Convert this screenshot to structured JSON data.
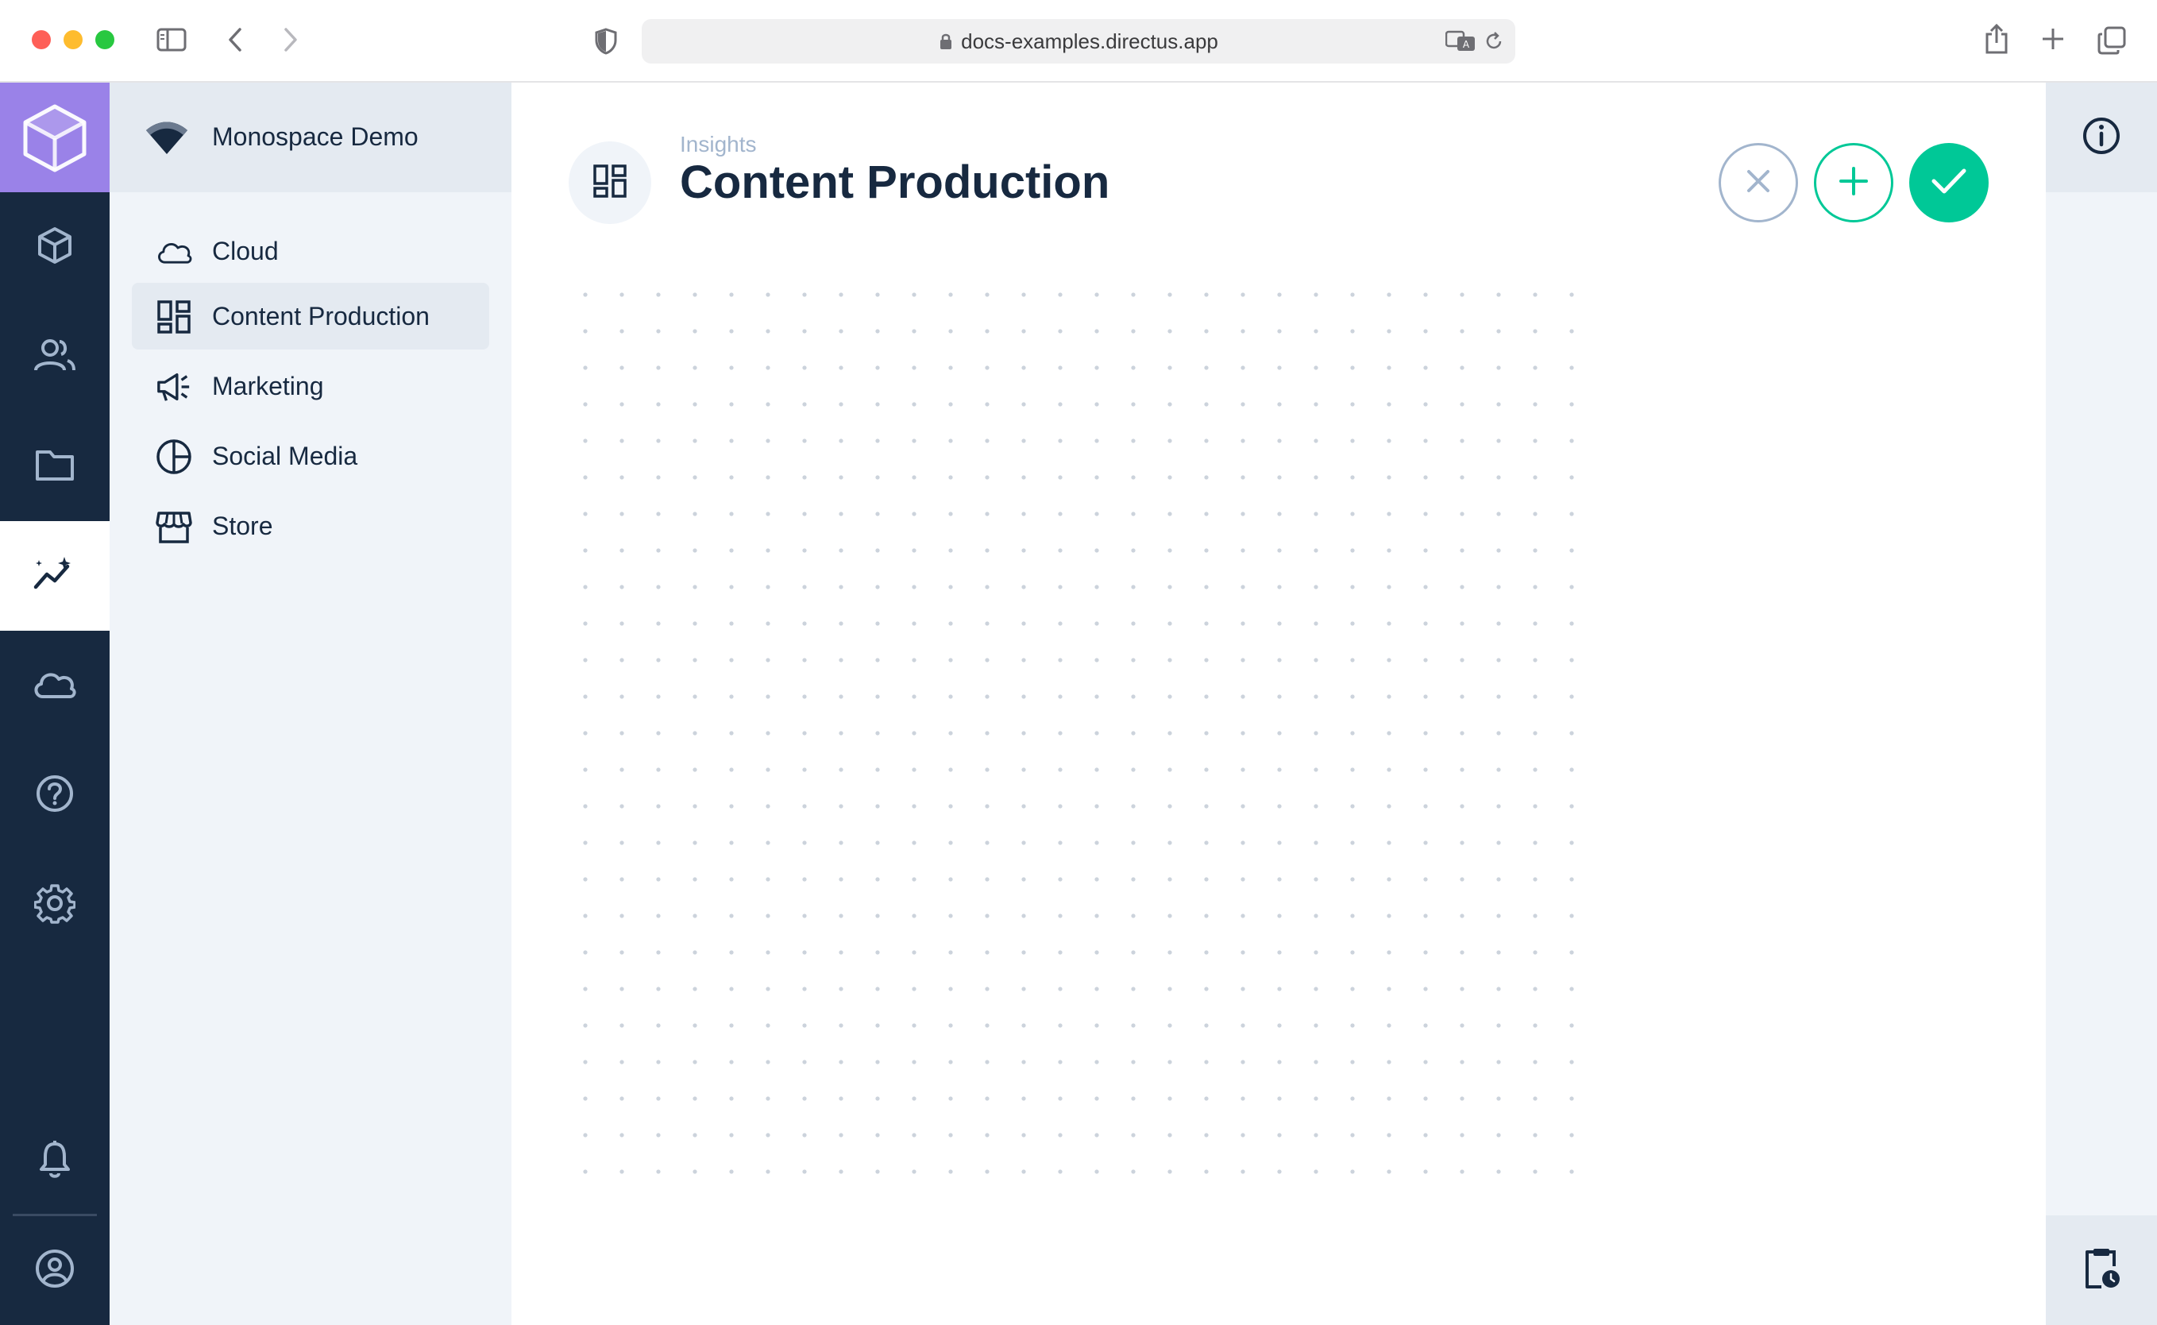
{
  "browser": {
    "url": "docs-examples.directus.app"
  },
  "colors": {
    "accent": "#00c897",
    "module_bar": "#172940",
    "logo_bg": "#9a82e8",
    "nav_bg": "#f0f4f9",
    "text": "#172940",
    "muted": "#a2b5cd"
  },
  "module_bar": {
    "items": [
      {
        "icon": "box-icon",
        "name": "Content"
      },
      {
        "icon": "users-icon",
        "name": "User Directory"
      },
      {
        "icon": "folder-icon",
        "name": "File Library"
      },
      {
        "icon": "insights-icon",
        "name": "Insights",
        "active": true
      },
      {
        "icon": "cloud-icon",
        "name": "Cloud"
      },
      {
        "icon": "help-icon",
        "name": "Help"
      },
      {
        "icon": "settings-icon",
        "name": "Settings"
      },
      {
        "icon": "bell-icon",
        "name": "Notifications"
      },
      {
        "icon": "user-circle-icon",
        "name": "Account"
      }
    ]
  },
  "sidebar": {
    "project_name": "Monospace Demo",
    "items": [
      {
        "label": "Cloud",
        "icon": "cloud-icon"
      },
      {
        "label": "Content Production",
        "icon": "dashboard-icon",
        "active": true
      },
      {
        "label": "Marketing",
        "icon": "megaphone-icon"
      },
      {
        "label": "Social Media",
        "icon": "pie-chart-icon"
      },
      {
        "label": "Store",
        "icon": "storefront-icon"
      }
    ]
  },
  "header": {
    "breadcrumb": "Insights",
    "title": "Content Production",
    "title_icon": "dashboard-icon"
  },
  "actions": {
    "cancel_icon": "close-icon",
    "add_icon": "plus-icon",
    "save_icon": "check-icon"
  },
  "right_sidebar": {
    "top_icon": "info-icon",
    "bottom_icon": "clipboard-clock-icon"
  }
}
